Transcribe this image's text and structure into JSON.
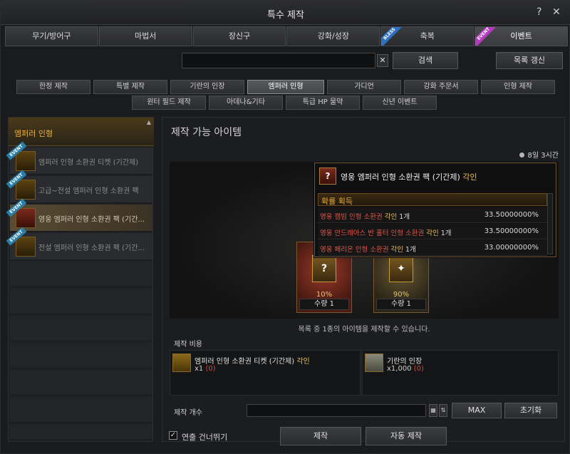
{
  "window": {
    "title": "특수 제작",
    "help_label": "?",
    "close_label": "✕"
  },
  "category_tabs": [
    {
      "label": "무기/방어구",
      "ribbon": ""
    },
    {
      "label": "마법서",
      "ribbon": ""
    },
    {
      "label": "장신구",
      "ribbon": ""
    },
    {
      "label": "강화/성장",
      "ribbon": ""
    },
    {
      "label": "축복",
      "ribbon": "BLESS"
    },
    {
      "label": "이벤트",
      "ribbon": "EVENT"
    }
  ],
  "category_ribbon_colors": {
    "BLESS": "#2d6fc1",
    "EVENT": "#b53ac2"
  },
  "search": {
    "placeholder": "",
    "clear_label": "✕",
    "search_label": "검색",
    "refresh_label": "목록 갱신"
  },
  "sub_tabs_row1": [
    "한정 제작",
    "특별 제작",
    "기란의 인장",
    "엠퍼러 인형",
    "가디언",
    "강화 주문서",
    "인형 제작"
  ],
  "sub_tabs_row2": [
    "윈터 필드 제작",
    "아데나&기타",
    "특급 HP 물약",
    "신년 이벤트"
  ],
  "active_sub_tab": "엠퍼러 인형",
  "left_list": {
    "header": "엠퍼러 인형",
    "items": [
      {
        "label": "엠퍼러 인형 소환권 티켓 (기간제)",
        "ribbon": "EVENT"
      },
      {
        "label": "고급~전설 엠퍼러 인형 소환권 팩",
        "ribbon": "EVENT"
      },
      {
        "label": "영웅 엠퍼러 인형 소환권 팩 (기간...",
        "ribbon": "EVENT"
      },
      {
        "label": "전설 엠퍼러 인형 소환권 팩 (기간...",
        "ribbon": "EVENT"
      }
    ]
  },
  "craft": {
    "title": "제작 가능 아이템",
    "timer": "8일 3시간",
    "cards": [
      {
        "percent": "10%",
        "qty_label": "수량 1",
        "icon": "?"
      },
      {
        "percent": "90%",
        "qty_label": "수량 1",
        "icon": "✦"
      }
    ],
    "info_text": "목록 중 1종의 아이템을 제작할 수 있습니다."
  },
  "tooltip": {
    "title": "영웅 엠퍼러 인형 소환권 팩 (기간제)",
    "title_tag": "각인",
    "icon": "?",
    "section_label": "확률 획득",
    "rows": [
      {
        "name": "영웅 캠빔 인형 소환권",
        "tag": "각인",
        "qty": "1개",
        "percent": "33.50000000%"
      },
      {
        "name": "영웅 안드레아스 반 홀터 인형 소환권",
        "tag": "각인",
        "qty": "1개",
        "percent": "33.50000000%"
      },
      {
        "name": "영웅 페리온 인형 소환권",
        "tag": "각인",
        "qty": "1개",
        "percent": "33.00000000%"
      }
    ]
  },
  "cost": {
    "label": "제작 비용",
    "items": [
      {
        "name": "엠퍼러 인형 소환권 티켓 (기간제)",
        "tag": "각인",
        "qty": "x1",
        "have": "(0)"
      },
      {
        "name": "기란의 인장",
        "tag": "",
        "qty": "x1,000",
        "have": "(0)"
      }
    ]
  },
  "count": {
    "label": "제작 개수",
    "max_label": "MAX",
    "reset_label": "초기화"
  },
  "bottom": {
    "skip_label": "연출 건너뛰기",
    "craft_label": "제작",
    "auto_craft_label": "자동 제작"
  }
}
